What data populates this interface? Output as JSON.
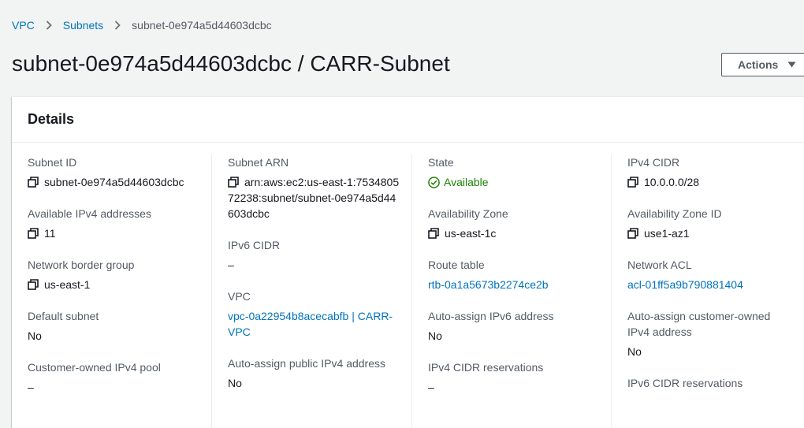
{
  "breadcrumb": {
    "vpc": "VPC",
    "subnets": "Subnets",
    "current": "subnet-0e974a5d44603dcbc"
  },
  "header": {
    "title": "subnet-0e974a5d44603dcbc / CARR-Subnet",
    "actions_label": "Actions"
  },
  "details": {
    "heading": "Details",
    "col1": {
      "subnet_id_label": "Subnet ID",
      "subnet_id": "subnet-0e974a5d44603dcbc",
      "available_ipv4_label": "Available IPv4 addresses",
      "available_ipv4": "11",
      "network_border_group_label": "Network border group",
      "network_border_group": "us-east-1",
      "default_subnet_label": "Default subnet",
      "default_subnet": "No",
      "customer_owned_pool_label": "Customer-owned IPv4 pool",
      "customer_owned_pool": "–"
    },
    "col2": {
      "subnet_arn_label": "Subnet ARN",
      "subnet_arn": "arn:aws:ec2:us-east-1:753480572238:subnet/subnet-0e974a5d44603dcbc",
      "ipv6_cidr_label": "IPv6 CIDR",
      "ipv6_cidr": "–",
      "vpc_label": "VPC",
      "vpc": "vpc-0a22954b8acecabfb | CARR-VPC",
      "auto_assign_public_label": "Auto-assign public IPv4 address",
      "auto_assign_public": "No"
    },
    "col3": {
      "state_label": "State",
      "state": "Available",
      "az_label": "Availability Zone",
      "az": "us-east-1c",
      "route_table_label": "Route table",
      "route_table": "rtb-0a1a5673b2274ce2b",
      "auto_ipv6_label": "Auto-assign IPv6 address",
      "auto_ipv6": "No",
      "ipv4_reservations_label": "IPv4 CIDR reservations",
      "ipv4_reservations": "–"
    },
    "col4": {
      "ipv4_cidr_label": "IPv4 CIDR",
      "ipv4_cidr": "10.0.0.0/28",
      "az_id_label": "Availability Zone ID",
      "az_id": "use1-az1",
      "nacl_label": "Network ACL",
      "nacl": "acl-01ff5a9b790881404",
      "auto_customer_owned_label": "Auto-assign customer-owned IPv4 address",
      "auto_customer_owned": "No",
      "ipv6_reservations_label": "IPv6 CIDR reservations"
    }
  },
  "colors": {
    "link": "#0073bb",
    "success": "#1d8102",
    "text": "#16191f",
    "label": "#545b64"
  },
  "icons": {
    "copy": "copy-icon",
    "status": "check-circle-icon",
    "separator": "chevron-right-icon",
    "dropdown": "caret-down-icon"
  }
}
